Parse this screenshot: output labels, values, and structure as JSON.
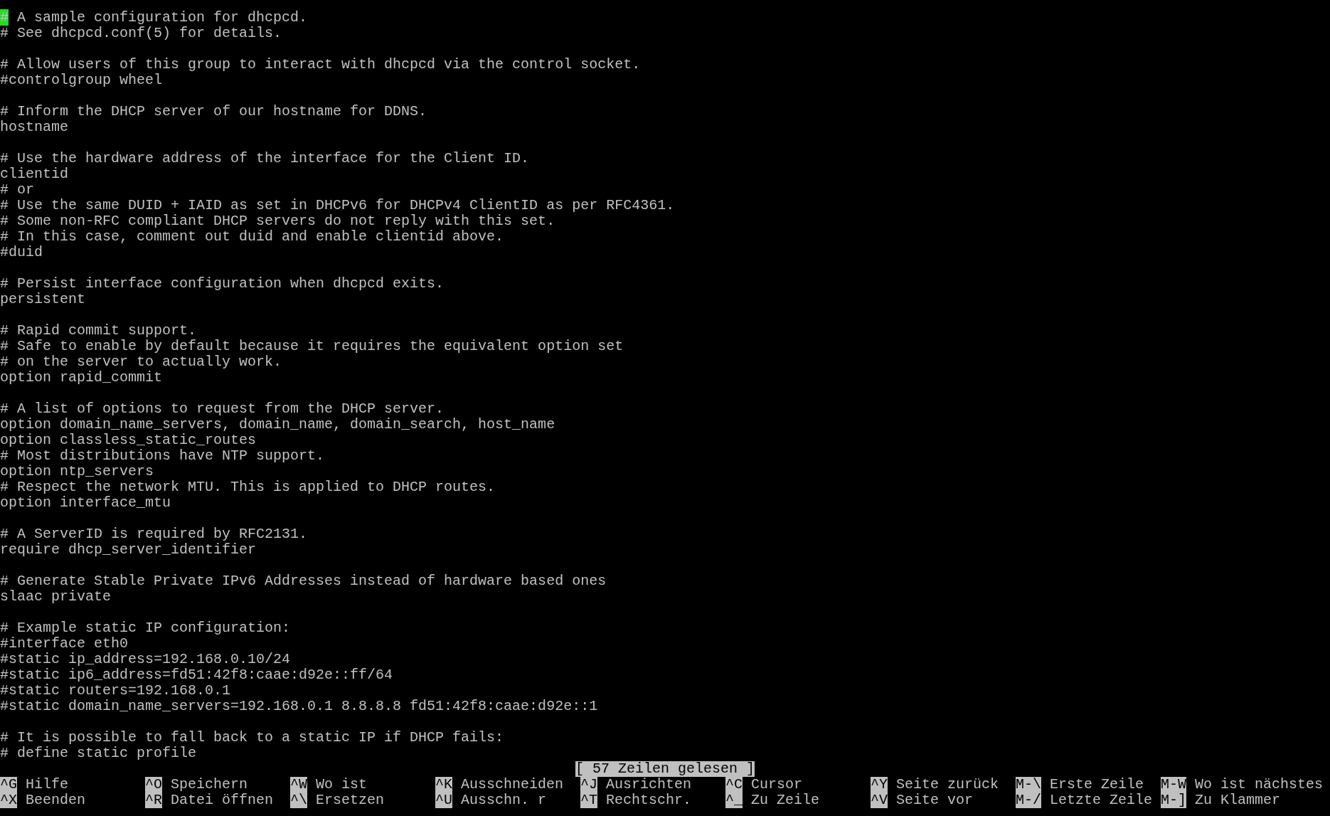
{
  "editor": {
    "lines": [
      {
        "kind": "text",
        "text": "# A sample configuration for dhcpcd."
      },
      {
        "kind": "text",
        "text": "# See dhcpcd.conf(5) for details."
      },
      {
        "kind": "blank"
      },
      {
        "kind": "text",
        "text": "# Allow users of this group to interact with dhcpcd via the control socket."
      },
      {
        "kind": "text",
        "text": "#controlgroup wheel"
      },
      {
        "kind": "blank"
      },
      {
        "kind": "text",
        "text": "# Inform the DHCP server of our hostname for DDNS."
      },
      {
        "kind": "text",
        "text": "hostname"
      },
      {
        "kind": "blank"
      },
      {
        "kind": "text",
        "text": "# Use the hardware address of the interface for the Client ID."
      },
      {
        "kind": "text",
        "text": "clientid"
      },
      {
        "kind": "text",
        "text": "# or"
      },
      {
        "kind": "text",
        "text": "# Use the same DUID + IAID as set in DHCPv6 for DHCPv4 ClientID as per RFC4361."
      },
      {
        "kind": "text",
        "text": "# Some non-RFC compliant DHCP servers do not reply with this set."
      },
      {
        "kind": "text",
        "text": "# In this case, comment out duid and enable clientid above."
      },
      {
        "kind": "text",
        "text": "#duid"
      },
      {
        "kind": "blank"
      },
      {
        "kind": "text",
        "text": "# Persist interface configuration when dhcpcd exits."
      },
      {
        "kind": "text",
        "text": "persistent"
      },
      {
        "kind": "blank"
      },
      {
        "kind": "text",
        "text": "# Rapid commit support."
      },
      {
        "kind": "text",
        "text": "# Safe to enable by default because it requires the equivalent option set"
      },
      {
        "kind": "text",
        "text": "# on the server to actually work."
      },
      {
        "kind": "text",
        "text": "option rapid_commit"
      },
      {
        "kind": "blank"
      },
      {
        "kind": "text",
        "text": "# A list of options to request from the DHCP server."
      },
      {
        "kind": "text",
        "text": "option domain_name_servers, domain_name, domain_search, host_name"
      },
      {
        "kind": "text",
        "text": "option classless_static_routes"
      },
      {
        "kind": "text",
        "text": "# Most distributions have NTP support."
      },
      {
        "kind": "text",
        "text": "option ntp_servers"
      },
      {
        "kind": "text",
        "text": "# Respect the network MTU. This is applied to DHCP routes."
      },
      {
        "kind": "text",
        "text": "option interface_mtu"
      },
      {
        "kind": "blank"
      },
      {
        "kind": "text",
        "text": "# A ServerID is required by RFC2131."
      },
      {
        "kind": "text",
        "text": "require dhcp_server_identifier"
      },
      {
        "kind": "blank"
      },
      {
        "kind": "text",
        "text": "# Generate Stable Private IPv6 Addresses instead of hardware based ones"
      },
      {
        "kind": "text",
        "text": "slaac private"
      },
      {
        "kind": "blank"
      },
      {
        "kind": "text",
        "text": "# Example static IP configuration:"
      },
      {
        "kind": "text",
        "text": "#interface eth0"
      },
      {
        "kind": "text",
        "text": "#static ip_address=192.168.0.10/24"
      },
      {
        "kind": "text",
        "text": "#static ip6_address=fd51:42f8:caae:d92e::ff/64"
      },
      {
        "kind": "text",
        "text": "#static routers=192.168.0.1"
      },
      {
        "kind": "text",
        "text": "#static domain_name_servers=192.168.0.1 8.8.8.8 fd51:42f8:caae:d92e::1"
      },
      {
        "kind": "blank"
      },
      {
        "kind": "text",
        "text": "# It is possible to fall back to a static IP if DHCP fails:"
      },
      {
        "kind": "text",
        "text": "# define static profile"
      }
    ]
  },
  "status_message": "[ 57 Zeilen gelesen ]",
  "shortcut_rows": [
    {
      "items": [
        {
          "key": "^G",
          "label": "Hilfe"
        },
        {
          "key": "^O",
          "label": "Speichern"
        },
        {
          "key": "^W",
          "label": "Wo ist"
        },
        {
          "key": "^K",
          "label": "Ausschneiden"
        },
        {
          "key": "^J",
          "label": "Ausrichten"
        },
        {
          "key": "^C",
          "label": "Cursor"
        },
        {
          "key": "^Y",
          "label": "Seite zurück"
        },
        {
          "key": "M-\\",
          "label": "Erste Zeile"
        },
        {
          "key": "M-W",
          "label": "Wo ist nächstes"
        }
      ]
    },
    {
      "items": [
        {
          "key": "^X",
          "label": "Beenden"
        },
        {
          "key": "^R",
          "label": "Datei öffnen"
        },
        {
          "key": "^\\",
          "label": "Ersetzen"
        },
        {
          "key": "^U",
          "label": "Ausschn. r"
        },
        {
          "key": "^T",
          "label": "Rechtschr."
        },
        {
          "key": "^_",
          "label": "Zu Zeile"
        },
        {
          "key": "^V",
          "label": "Seite vor"
        },
        {
          "key": "M-/",
          "label": "Letzte Zeile"
        },
        {
          "key": "M-]",
          "label": "Zu Klammer"
        }
      ]
    }
  ]
}
